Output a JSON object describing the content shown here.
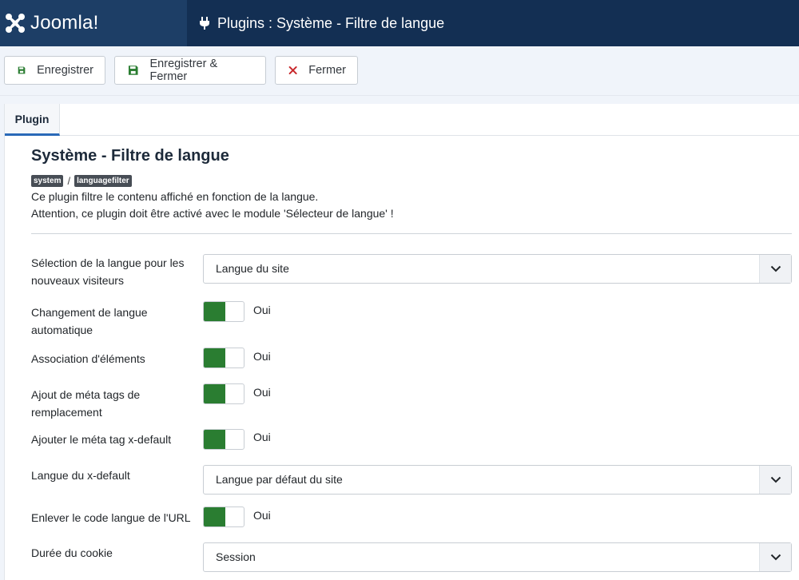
{
  "header": {
    "logo_text": "Joomla!",
    "title": "Plugins : Système - Filtre de langue"
  },
  "toolbar": {
    "save_label": "Enregistrer",
    "save_close_label": "Enregistrer & Fermer",
    "close_label": "Fermer"
  },
  "tabs": {
    "plugin": "Plugin"
  },
  "plugin": {
    "title": "Système - Filtre de langue",
    "folder_badge": "system",
    "element_badge": "languagefilter",
    "badge_sep": "/",
    "desc_line1": "Ce plugin filtre le contenu affiché en fonction de la langue.",
    "desc_line2": "Attention, ce plugin doit être activé avec le module 'Sélecteur de langue' !"
  },
  "fields": {
    "new_visitors": {
      "label": "Sélection de la langue pour les nouveaux visiteurs",
      "value": "Langue du site"
    },
    "auto_change": {
      "label": "Changement de langue automatique",
      "value": "Oui"
    },
    "item_assoc": {
      "label": "Association d'éléments",
      "value": "Oui"
    },
    "alternate_meta": {
      "label": "Ajout de méta tags de remplacement",
      "value": "Oui"
    },
    "xdefault": {
      "label": "Ajouter le méta tag x-default",
      "value": "Oui"
    },
    "xdefault_lang": {
      "label": "Langue du x-default",
      "value": "Langue par défaut du site"
    },
    "remove_code": {
      "label": "Enlever le code langue de l'URL",
      "value": "Oui"
    },
    "cookie": {
      "label": "Durée du cookie",
      "value": "Session"
    }
  },
  "colors": {
    "header_bg": "#132f53",
    "logo_bg": "#1d3e66",
    "switch_on": "#2a7d31",
    "tab_accent": "#2a69b8",
    "save_icon": "#2a7d31",
    "close_icon": "#c8262a"
  }
}
